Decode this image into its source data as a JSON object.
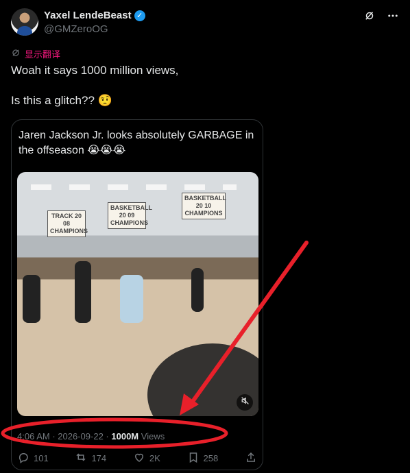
{
  "author": {
    "display_name": "Yaxel LendeBeast",
    "handle": "@GMZeroOG",
    "verified": true
  },
  "translate_label": "显示翻译",
  "tweet_text": {
    "line1": "Woah it says 1000 million views,",
    "line2": "Is this a glitch?? 🤨"
  },
  "quote": {
    "text": "Jaren Jackson Jr. looks absolutely GARBAGE in the offseason 😭😭😭",
    "media": {
      "banner_left": "TRACK 20 08 CHAMPIONS",
      "banner_mid": "BASKETBALL 20 09 CHAMPIONS",
      "banner_right": "BASKETBALL 20 10 CHAMPIONS"
    },
    "meta": {
      "time": "4:06 AM",
      "sep": "·",
      "date": "2026-09-22",
      "views_count": "1000M",
      "views_label": "Views"
    },
    "actions": {
      "replies": "101",
      "reposts": "174",
      "likes": "2K",
      "bookmarks": "258"
    }
  },
  "colors": {
    "background": "#000000",
    "text": "#e7e9ea",
    "muted": "#71767b",
    "accent": "#1d9bf0",
    "translate": "#f91880",
    "annotation": "#e8202a"
  },
  "icons": [
    "grok-icon",
    "more-icon",
    "translate-icon",
    "mute-icon",
    "reply-icon",
    "repost-icon",
    "like-icon",
    "bookmark-icon",
    "share-icon"
  ]
}
